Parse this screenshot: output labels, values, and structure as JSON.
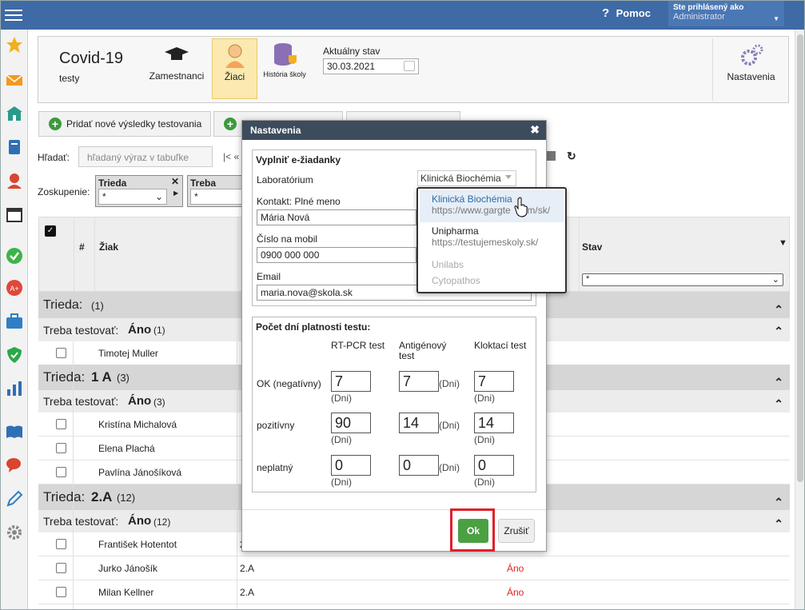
{
  "topbar": {
    "help": "Pomoc",
    "logged_label": "Ste prihlásený ako",
    "logged_user": "Administrator"
  },
  "ribbon": {
    "title": "Covid-19",
    "subtitle": "testy",
    "btn_zamestnanci": "Zamestnanci",
    "btn_ziaci": "Žiaci",
    "btn_historia": "História školy",
    "stav_label": "Aktuálny stav",
    "stav_date": "30.03.2021",
    "nastavenia": "Nastavenia"
  },
  "toolbar": {
    "add_results": "Pridať nové výsledky testovania"
  },
  "filter": {
    "search_label": "Hľadať:",
    "search_placeholder": "hľadaný výraz v tabuľke",
    "pager": "|< «",
    "group_label": "Zoskupenie:"
  },
  "groups": [
    {
      "title": "Trieda",
      "value": "*"
    },
    {
      "title": "Treba testov",
      "value": "*"
    }
  ],
  "table": {
    "col_num": "#",
    "col_name": "Žiak",
    "col_stav": "Stav",
    "stav_filter": "*",
    "bands": [
      {
        "label": "Trieda:",
        "value": "",
        "count": "(1)"
      },
      {
        "label": "Trieda:",
        "value": "1 A",
        "count": "(3)"
      },
      {
        "label": "Trieda:",
        "value": "2.A",
        "count": "(12)"
      }
    ],
    "subbands": [
      {
        "label": "Treba testovať:",
        "value": "Áno",
        "count": "(1)"
      },
      {
        "label": "Treba testovať:",
        "value": "Áno",
        "count": "(3)"
      },
      {
        "label": "Treba testovať:",
        "value": "Áno",
        "count": "(12)"
      }
    ],
    "rows": [
      {
        "name": "Timotej Muller",
        "class": "",
        "stav": ""
      },
      {
        "name": "Kristína Michalová",
        "class": "",
        "stav": ""
      },
      {
        "name": "Elena Plachá",
        "class": "",
        "stav": ""
      },
      {
        "name": "Pavlína Jánošíková",
        "class": "",
        "stav": ""
      },
      {
        "name": "František Hotentot",
        "class": "2.A",
        "stav": ""
      },
      {
        "name": "Jurko Jánošík",
        "class": "2.A",
        "stav": "Áno"
      },
      {
        "name": "Milan Kellner",
        "class": "2.A",
        "stav": "Áno"
      }
    ]
  },
  "modal": {
    "title": "Nastavenia",
    "section1": "Vyplniť e-žiadanky",
    "lab_label": "Laboratórium",
    "lab_value": "Klinická Biochémia",
    "contact_label": "Kontakt: Plné meno",
    "contact_value": "Mária Nová",
    "mobile_label": "Číslo na mobil",
    "mobile_value": "0900 000 000",
    "email_label": "Email",
    "email_value": "maria.nova@skola.sk",
    "section2": "Počet dní platnosti testu:",
    "col1": "RT-PCR test",
    "col2a": "Antigénový",
    "col2b": "test",
    "col3": "Kloktací test",
    "unit": "(Dni)",
    "rows": [
      {
        "label": "OK (negatívny)",
        "v": [
          "7",
          "7",
          "7"
        ]
      },
      {
        "label": "pozitívny",
        "v": [
          "90",
          "14",
          "14"
        ]
      },
      {
        "label": "neplatný",
        "v": [
          "0",
          "0",
          "0"
        ]
      }
    ],
    "ok": "Ok",
    "cancel": "Zrušiť"
  },
  "dropdown": [
    {
      "name": "Klinická Biochémia",
      "url": "https://www.gargte",
      "url_tail": "om/sk/"
    },
    {
      "name": "Unipharma",
      "url": "https://testujemeskoly.sk/"
    },
    {
      "name": "Unilabs"
    },
    {
      "name": "Cytopathos"
    }
  ]
}
